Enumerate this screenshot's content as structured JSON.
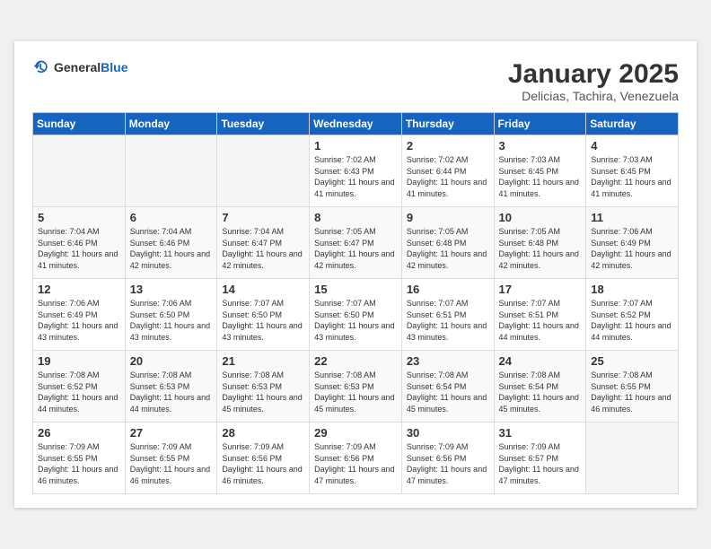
{
  "header": {
    "logo_general": "General",
    "logo_blue": "Blue",
    "title": "January 2025",
    "subtitle": "Delicias, Tachira, Venezuela"
  },
  "weekdays": [
    "Sunday",
    "Monday",
    "Tuesday",
    "Wednesday",
    "Thursday",
    "Friday",
    "Saturday"
  ],
  "weeks": [
    [
      {
        "day": "",
        "info": ""
      },
      {
        "day": "",
        "info": ""
      },
      {
        "day": "",
        "info": ""
      },
      {
        "day": "1",
        "info": "Sunrise: 7:02 AM\nSunset: 6:43 PM\nDaylight: 11 hours and 41 minutes."
      },
      {
        "day": "2",
        "info": "Sunrise: 7:02 AM\nSunset: 6:44 PM\nDaylight: 11 hours and 41 minutes."
      },
      {
        "day": "3",
        "info": "Sunrise: 7:03 AM\nSunset: 6:45 PM\nDaylight: 11 hours and 41 minutes."
      },
      {
        "day": "4",
        "info": "Sunrise: 7:03 AM\nSunset: 6:45 PM\nDaylight: 11 hours and 41 minutes."
      }
    ],
    [
      {
        "day": "5",
        "info": "Sunrise: 7:04 AM\nSunset: 6:46 PM\nDaylight: 11 hours and 41 minutes."
      },
      {
        "day": "6",
        "info": "Sunrise: 7:04 AM\nSunset: 6:46 PM\nDaylight: 11 hours and 42 minutes."
      },
      {
        "day": "7",
        "info": "Sunrise: 7:04 AM\nSunset: 6:47 PM\nDaylight: 11 hours and 42 minutes."
      },
      {
        "day": "8",
        "info": "Sunrise: 7:05 AM\nSunset: 6:47 PM\nDaylight: 11 hours and 42 minutes."
      },
      {
        "day": "9",
        "info": "Sunrise: 7:05 AM\nSunset: 6:48 PM\nDaylight: 11 hours and 42 minutes."
      },
      {
        "day": "10",
        "info": "Sunrise: 7:05 AM\nSunset: 6:48 PM\nDaylight: 11 hours and 42 minutes."
      },
      {
        "day": "11",
        "info": "Sunrise: 7:06 AM\nSunset: 6:49 PM\nDaylight: 11 hours and 42 minutes."
      }
    ],
    [
      {
        "day": "12",
        "info": "Sunrise: 7:06 AM\nSunset: 6:49 PM\nDaylight: 11 hours and 43 minutes."
      },
      {
        "day": "13",
        "info": "Sunrise: 7:06 AM\nSunset: 6:50 PM\nDaylight: 11 hours and 43 minutes."
      },
      {
        "day": "14",
        "info": "Sunrise: 7:07 AM\nSunset: 6:50 PM\nDaylight: 11 hours and 43 minutes."
      },
      {
        "day": "15",
        "info": "Sunrise: 7:07 AM\nSunset: 6:50 PM\nDaylight: 11 hours and 43 minutes."
      },
      {
        "day": "16",
        "info": "Sunrise: 7:07 AM\nSunset: 6:51 PM\nDaylight: 11 hours and 43 minutes."
      },
      {
        "day": "17",
        "info": "Sunrise: 7:07 AM\nSunset: 6:51 PM\nDaylight: 11 hours and 44 minutes."
      },
      {
        "day": "18",
        "info": "Sunrise: 7:07 AM\nSunset: 6:52 PM\nDaylight: 11 hours and 44 minutes."
      }
    ],
    [
      {
        "day": "19",
        "info": "Sunrise: 7:08 AM\nSunset: 6:52 PM\nDaylight: 11 hours and 44 minutes."
      },
      {
        "day": "20",
        "info": "Sunrise: 7:08 AM\nSunset: 6:53 PM\nDaylight: 11 hours and 44 minutes."
      },
      {
        "day": "21",
        "info": "Sunrise: 7:08 AM\nSunset: 6:53 PM\nDaylight: 11 hours and 45 minutes."
      },
      {
        "day": "22",
        "info": "Sunrise: 7:08 AM\nSunset: 6:53 PM\nDaylight: 11 hours and 45 minutes."
      },
      {
        "day": "23",
        "info": "Sunrise: 7:08 AM\nSunset: 6:54 PM\nDaylight: 11 hours and 45 minutes."
      },
      {
        "day": "24",
        "info": "Sunrise: 7:08 AM\nSunset: 6:54 PM\nDaylight: 11 hours and 45 minutes."
      },
      {
        "day": "25",
        "info": "Sunrise: 7:08 AM\nSunset: 6:55 PM\nDaylight: 11 hours and 46 minutes."
      }
    ],
    [
      {
        "day": "26",
        "info": "Sunrise: 7:09 AM\nSunset: 6:55 PM\nDaylight: 11 hours and 46 minutes."
      },
      {
        "day": "27",
        "info": "Sunrise: 7:09 AM\nSunset: 6:55 PM\nDaylight: 11 hours and 46 minutes."
      },
      {
        "day": "28",
        "info": "Sunrise: 7:09 AM\nSunset: 6:56 PM\nDaylight: 11 hours and 46 minutes."
      },
      {
        "day": "29",
        "info": "Sunrise: 7:09 AM\nSunset: 6:56 PM\nDaylight: 11 hours and 47 minutes."
      },
      {
        "day": "30",
        "info": "Sunrise: 7:09 AM\nSunset: 6:56 PM\nDaylight: 11 hours and 47 minutes."
      },
      {
        "day": "31",
        "info": "Sunrise: 7:09 AM\nSunset: 6:57 PM\nDaylight: 11 hours and 47 minutes."
      },
      {
        "day": "",
        "info": ""
      }
    ]
  ]
}
